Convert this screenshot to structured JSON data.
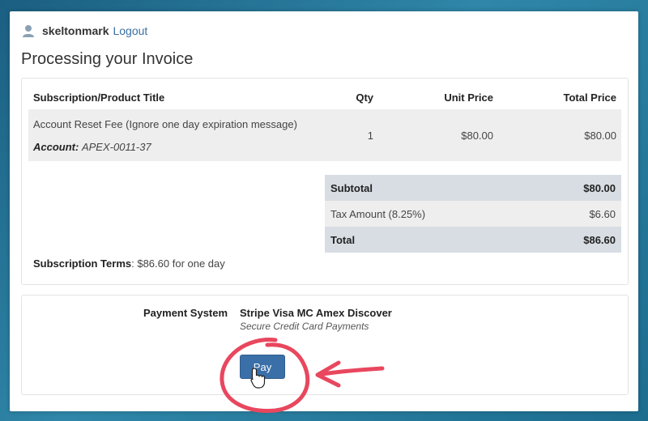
{
  "user": {
    "username": "skeltonmark",
    "logout_label": "Logout"
  },
  "page": {
    "title": "Processing your Invoice"
  },
  "items_table": {
    "headers": {
      "title": "Subscription/Product Title",
      "qty": "Qty",
      "unit_price": "Unit Price",
      "total_price": "Total Price"
    },
    "rows": [
      {
        "title": "Account Reset Fee (Ignore one day expiration message)",
        "account_label": "Account:",
        "account_value": "APEX-0011-37",
        "qty": "1",
        "unit_price": "$80.00",
        "total_price": "$80.00"
      }
    ]
  },
  "totals": {
    "subtotal_label": "Subtotal",
    "subtotal_value": "$80.00",
    "tax_label": "Tax Amount (8.25%)",
    "tax_value": "$6.60",
    "total_label": "Total",
    "total_value": "$86.60"
  },
  "subscription_terms": {
    "label": "Subscription Terms",
    "value": ": $86.60 for one day"
  },
  "payment": {
    "label": "Payment System",
    "system_name": "Stripe Visa MC Amex Discover",
    "description": "Secure Credit Card Payments",
    "pay_button_label": "Pay"
  },
  "icons": {
    "user": "user-icon",
    "cursor": "hand-pointer-icon"
  },
  "colors": {
    "pay_button": "#3a6fa8",
    "annotation": "#e8475e",
    "link": "#3a6fa0"
  }
}
